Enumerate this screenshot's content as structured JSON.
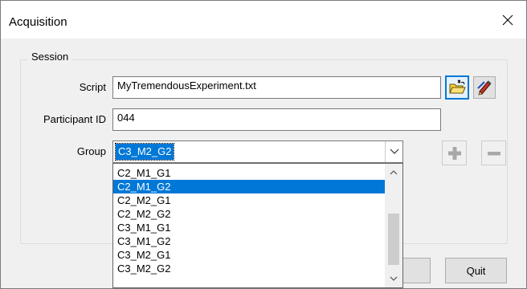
{
  "window": {
    "title": "Acquisition",
    "close_glyph": "×"
  },
  "session": {
    "group_label": "Session",
    "script": {
      "label": "Script",
      "value": "MyTremendousExperiment.txt",
      "open_icon": "open-folder-icon",
      "edit_icon": "edit-pencil-icon"
    },
    "participant": {
      "label": "Participant ID",
      "value": "044"
    },
    "group": {
      "label": "Group",
      "selected": "C3_M2_G2",
      "add_icon": "plus-icon",
      "remove_icon": "minus-icon",
      "options": [
        {
          "label": "C2_M1_G1",
          "highlighted": false
        },
        {
          "label": "C2_M1_G2",
          "highlighted": true
        },
        {
          "label": "C2_M2_G1",
          "highlighted": false
        },
        {
          "label": "C2_M2_G2",
          "highlighted": false
        },
        {
          "label": "C3_M1_G1",
          "highlighted": false
        },
        {
          "label": "C3_M1_G2",
          "highlighted": false
        },
        {
          "label": "C3_M2_G1",
          "highlighted": false
        },
        {
          "label": "C3_M2_G2",
          "highlighted": false
        }
      ]
    }
  },
  "buttons": {
    "quit_label": "Quit"
  },
  "colors": {
    "accent": "#0078d7",
    "dialog_bg": "#f0f0f0"
  }
}
